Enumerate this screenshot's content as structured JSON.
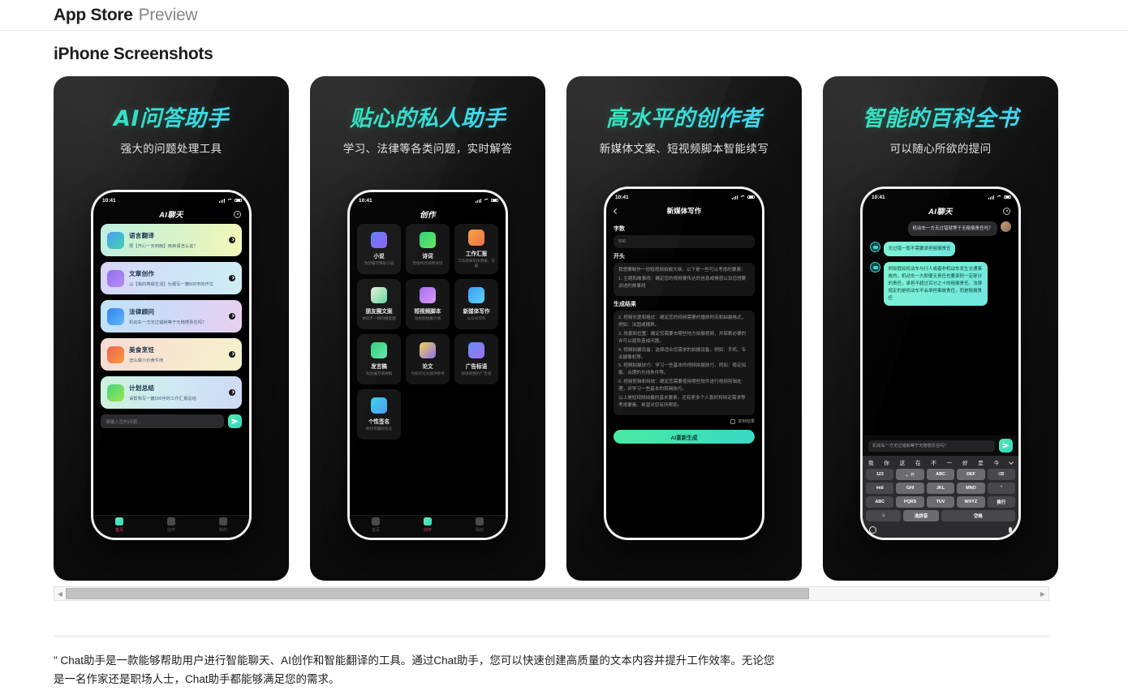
{
  "header": {
    "brand": "App Store",
    "sub": "Preview"
  },
  "section_title": "iPhone Screenshots",
  "scrollbar": {
    "left_arrow": "◀",
    "right_arrow": "▶"
  },
  "description": "\" Chat助手是一款能够帮助用户进行智能聊天、AI创作和智能翻译的工具。通过Chat助手，您可以快速创建高质量的文本内容并提升工作效率。无论您是一名作家还是职场人士，Chat助手都能够满足您的需求。",
  "colors": {
    "accent_teal": "#35d7c6",
    "accent_green": "#4ee8a6",
    "panel_bg": "#111111",
    "tab_active": "#ff3b6b"
  },
  "status_bar": {
    "time": "10:41"
  },
  "shots": [
    {
      "title": "AI问答助手",
      "subtitle": "强大的问题处理工具",
      "nav_title": "AI聊天",
      "list": [
        {
          "name": "语言翻译",
          "desc": "把【开心一天到晚】用英语怎么说？",
          "grad": "linear-gradient(100deg,#bdf0e0,#d6f3c9,#f3f6b8)",
          "icon_grad": "linear-gradient(135deg,#4c9bf5,#3ad3a8)"
        },
        {
          "name": "文章创作",
          "desc": "以【我的寒假生活】为题写一篇500字的作文",
          "grad": "linear-gradient(100deg,#d6d3f7,#cfe2f8,#cdeef2)",
          "icon_grad": "linear-gradient(135deg,#8a6cf0,#b98bf5)"
        },
        {
          "name": "法律顾问",
          "desc": "机动车一方无过错就等于无赔偿责任吗？",
          "grad": "linear-gradient(100deg,#bfe2f7,#cfd9f6,#e9cff0)",
          "icon_grad": "linear-gradient(135deg,#2f7ff0,#5fb8f7)"
        },
        {
          "name": "美食烹饪",
          "desc": "怎么做小炒黄牛肉",
          "grad": "linear-gradient(100deg,#f7dcd6,#f7e6cf,#f3f1cc)",
          "icon_grad": "linear-gradient(135deg,#f0604f,#f59b3c)"
        },
        {
          "name": "计划总结",
          "desc": "请帮我写一篇500字的工作汇报总结",
          "grad": "linear-gradient(100deg,#cdf2dd,#cfe9f3,#cfd8f5)",
          "icon_grad": "linear-gradient(135deg,#46d07a,#9ae84f)"
        }
      ],
      "input_placeholder": "请输入您的问题...",
      "tabs": [
        {
          "label": "首页",
          "active": true
        },
        {
          "label": "创作",
          "active": false
        },
        {
          "label": "我的",
          "active": false
        }
      ]
    },
    {
      "title": "贴心的私人助手",
      "subtitle": "学习、法律等各类问题，实时解答",
      "nav_title": "创作",
      "grid": [
        {
          "name": "小说",
          "desc": "为您编写精彩小说",
          "icon_grad": "linear-gradient(135deg,#5f7cf7,#8f5ff0)"
        },
        {
          "name": "诗词",
          "desc": "智能构思婉转诗词",
          "icon_grad": "linear-gradient(135deg,#2fd07a,#6ae85f)"
        },
        {
          "name": "工作汇报",
          "desc": "工作结果形体周报、日报",
          "icon_grad": "linear-gradient(135deg,#f5a33c,#f0734f)"
        },
        {
          "name": "朋友圈文案",
          "desc": "体验不一样的朋友圈",
          "icon_grad": "linear-gradient(135deg,#e8f0d8,#5fd8a0)"
        },
        {
          "name": "短视频脚本",
          "desc": "短视频拍摄大纲",
          "icon_grad": "linear-gradient(135deg,#a76ef0,#d79bf5)"
        },
        {
          "name": "新媒体写作",
          "desc": "公众号写作",
          "icon_grad": "linear-gradient(135deg,#3a9ef5,#5fd0f7)"
        },
        {
          "name": "发言稿",
          "desc": "为您编写演讲稿",
          "icon_grad": "linear-gradient(135deg,#2fd07a,#6ae8b0)"
        },
        {
          "name": "论文",
          "desc": "为您的论文提供参考",
          "icon_grad": "linear-gradient(135deg,#f0d44f,#8f6ff0)"
        },
        {
          "name": "广告标语",
          "desc": "标收同整的广告语",
          "icon_grad": "linear-gradient(135deg,#5f8ff7,#a76ef0)"
        },
        {
          "name": "个性签名",
          "desc": "制作有趣的签名",
          "icon_grad": "linear-gradient(135deg,#3ad3e8,#4c9bf5)"
        }
      ],
      "tabs": [
        {
          "label": "首页",
          "active": false
        },
        {
          "label": "创作",
          "active": true
        },
        {
          "label": "我的",
          "active": false
        }
      ]
    },
    {
      "title": "高水平的创作者",
      "subtitle": "新媒体文案、短视频脚本智能续写",
      "nav_title": "新媒体写作",
      "form": {
        "count_label": "字数",
        "count_value": "500",
        "start_label": "开头",
        "start_text_1": "我想要制作一份短视频拍摄大纲，以下是一些可以考虑的要素：",
        "start_text_2": "1. 主题和故事线：确定您的视频要传达的信息或情感以及您想要讲述的故事线",
        "result_label": "生成结果",
        "result_lines": [
          "2. 视频长度和格式：确定您的视频需要的播放时间和拍摄格式，例如：法国或横屏。",
          "3. 场景和位置：确定您需要去哪些地方拍摄视频，并探索必要的许可以避免造成问题。",
          "4. 视频拍摄设备：选择适合您需求的拍摄设备，例如：手机、专业摄像机等。",
          "5. 视频拍摄技巧：学习一些基本的视频拍摄技巧，例如：稳定拍摄、合理的光线条件等。",
          "6. 视频剪辑和特效：确定您需要使用哪些软件进行视频剪辑处理，并学习一些基本的剪辑技巧。",
          "以上是短视频拍摄的基本要素，还有更多个人喜好和特定需求等考虑要素。希望对您有所帮助。"
        ],
        "copy_label": "复制结果",
        "generate_button": "AI重新生成"
      }
    },
    {
      "title": "智能的百科全书",
      "subtitle": "可以随心所欲的提问",
      "nav_title": "AI聊天",
      "chat": [
        {
          "from": "me",
          "text": "机动车一方无过错就等于无赔偿责任吗？"
        },
        {
          "from": "ai",
          "text": "无过错一般不需要承担赔偿责任"
        },
        {
          "from": "ai",
          "text": "例如假如机动车与行人或者非机动车发生交通事故的，机动车一方即便无责任也要承担一定部分的责任，承担不超过百分之十的赔偿责任。法律规定的是机动车不会承担事故责任，而是赔偿责任"
        }
      ],
      "input_value": "机动车一方无过错就等于无赔偿责任吗？",
      "keyboard": {
        "suggestions": [
          "我",
          "你",
          "这",
          "在",
          "不",
          "一",
          "好",
          "是",
          "今"
        ],
        "row1": [
          "123",
          "。?!",
          "ABC",
          "DEF",
          "⌫"
        ],
        "row2": [
          "#¤¥",
          "GHI",
          "JKL",
          "MNO",
          "⌃"
        ],
        "row3": [
          "ABC",
          "PQRS",
          "TUV",
          "WXYZ",
          "换行"
        ],
        "row4": [
          "☺",
          "选拼音",
          "空格"
        ]
      }
    }
  ]
}
